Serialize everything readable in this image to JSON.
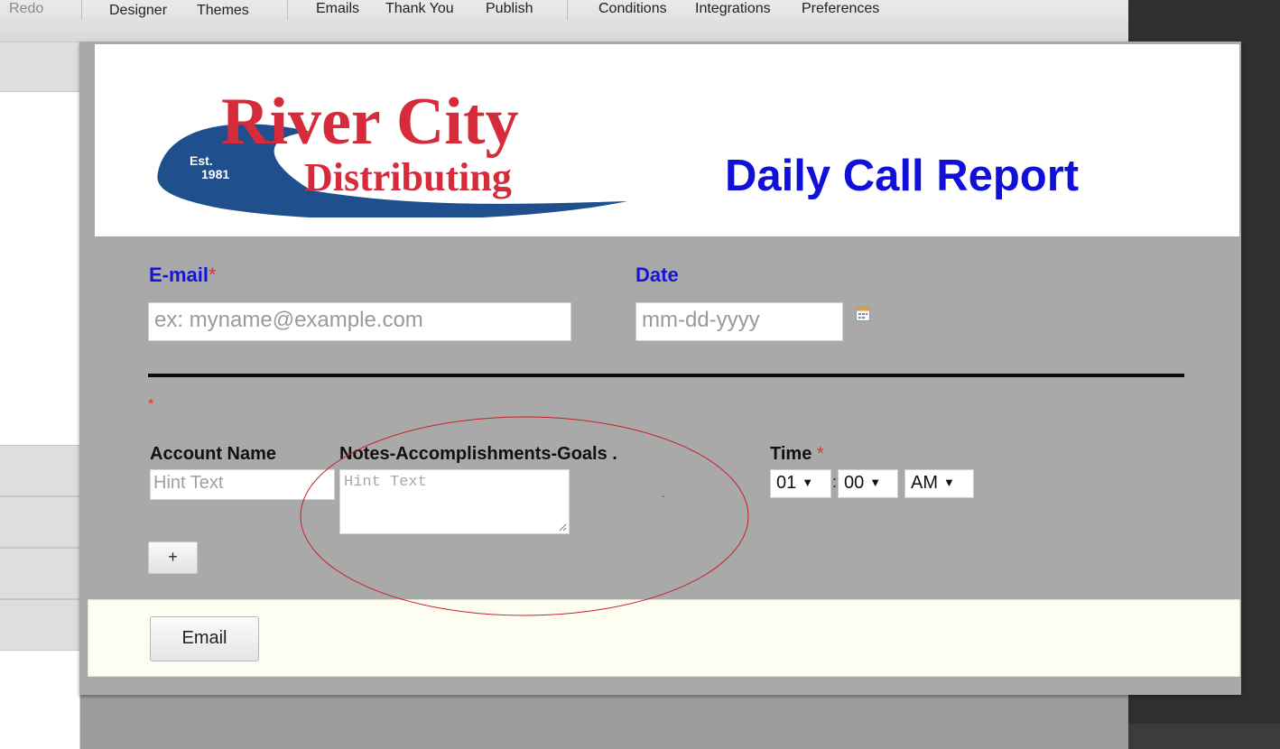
{
  "toolbar": {
    "redo": "Redo",
    "designer": "Designer",
    "themes": "Themes",
    "emails": "Emails",
    "thank_you": "Thank You",
    "publish": "Publish",
    "conditions": "Conditions",
    "integrations": "Integrations",
    "preferences": "Preferences"
  },
  "logo": {
    "est": "Est.",
    "year": "1981",
    "name_line1": "River City",
    "name_line2": "Distributing",
    "red": "#d62b3a",
    "blue": "#1f4f8c"
  },
  "form": {
    "title": "Daily Call Report",
    "email_label": "E-mail",
    "email_required": "*",
    "email_placeholder": "ex: myname@example.com",
    "date_label": "Date",
    "date_placeholder": "mm-dd-yyyy",
    "section_required": "*",
    "account_label": "Account Name",
    "account_placeholder": "Hint Text",
    "notes_label": "Notes-Accomplishments-Goals .",
    "notes_placeholder": "Hint Text",
    "dot": ".",
    "time_label": "Time",
    "time_required": "*",
    "time_hour": "01",
    "time_sep": ":",
    "time_minute": "00",
    "time_ampm": "AM",
    "add_row": "+",
    "submit": "Email"
  },
  "colors": {
    "title_blue": "#1010d8",
    "required_red": "#e23030",
    "canvas_gray": "#a9a9a9",
    "annotation_red": "#c8202b"
  }
}
